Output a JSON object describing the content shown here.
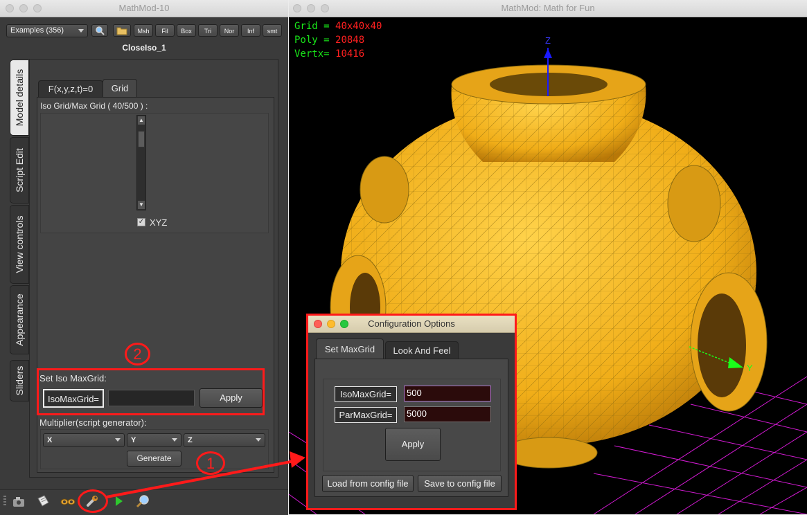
{
  "left_window": {
    "title": "MathMod-10",
    "toolbar": {
      "examples_combo": "Examples (356)",
      "buttons": [
        "Msh",
        "Fil",
        "Box",
        "Tri",
        "Nor",
        "Inf",
        "smt"
      ]
    },
    "model_name": "CloseIso_1",
    "side_tabs": [
      "Model details",
      "Script Edit",
      "View controls",
      "Appearance",
      "Sliders"
    ],
    "inner_tabs": [
      "F(x,y,z,t)=0",
      "Grid"
    ],
    "iso_grid_label": "Iso Grid/Max Grid ( 40/500 ) :",
    "xyz_checkbox_label": "XYZ",
    "xyz_checked": true,
    "set_iso_label": "Set Iso MaxGrid:",
    "isomaxgrid_label": "IsoMaxGrid=",
    "isomaxgrid_value": "",
    "apply_label": "Apply",
    "multiplier_label": "Multiplier(script generator):",
    "multiplier_combos": [
      "X",
      "Y",
      "Z"
    ],
    "generate_label": "Generate",
    "bottom_icons": [
      "grip-icon",
      "camera-icon",
      "document-icon",
      "goggles-icon",
      "wrench-icon",
      "play-icon",
      "magnifier-icon"
    ]
  },
  "right_window": {
    "title": "MathMod: Math for Fun",
    "hud": [
      {
        "key": "Grid = ",
        "value": "40x40x40"
      },
      {
        "key": "Poly = ",
        "value": "20848"
      },
      {
        "key": "Vertx= ",
        "value": "10416"
      }
    ],
    "axis_labels": {
      "z": "Z",
      "y": "Y"
    },
    "colors": {
      "surface": "#f2b21a",
      "grid_floor": "#d21ad2",
      "hud_key": "#19e619",
      "hud_value": "#ff2020",
      "axis_z": "#1a1aff",
      "axis_y": "#1aff1a"
    }
  },
  "dialog": {
    "title": "Configuration Options",
    "tabs": [
      "Set MaxGrid",
      "Look And Feel"
    ],
    "isomaxgrid_label": "IsoMaxGrid=",
    "isomaxgrid_value": "500",
    "parmaxgrid_label": "ParMaxGrid=",
    "parmaxgrid_value": "5000",
    "apply_label": "Apply",
    "load_label": "Load from config file",
    "save_label": "Save  to config file"
  },
  "annotations": {
    "step1": "1",
    "step2": "2"
  }
}
